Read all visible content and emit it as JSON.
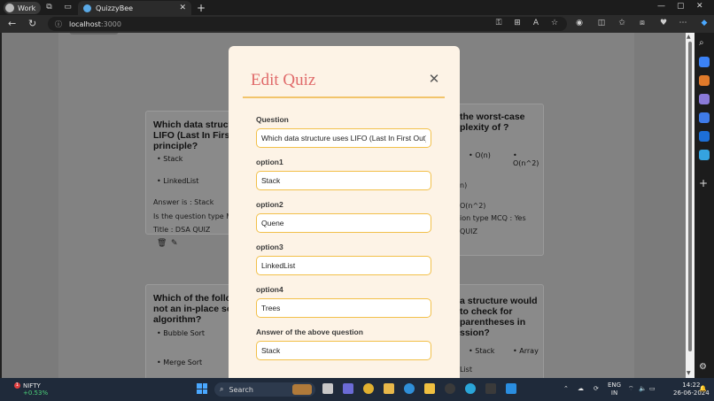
{
  "browser": {
    "profile_label": "Work",
    "tab_title": "QuizzyBee",
    "url_host": "localhost",
    "url_port": ":3000"
  },
  "modal": {
    "title": "Edit Quiz",
    "fields": [
      {
        "label": "Question",
        "value": "Which data structure uses LIFO (Last In First Out) principle?"
      },
      {
        "label": "option1",
        "value": "Stack"
      },
      {
        "label": "option2",
        "value": "Quene"
      },
      {
        "label": "option3",
        "value": "LinkedList"
      },
      {
        "label": "option4",
        "value": "Trees"
      },
      {
        "label": "Answer of the above question",
        "value": "Stack"
      }
    ]
  },
  "background_cards": {
    "card1": {
      "question_fragment": "Which data struct LIFO (Last In First principle?",
      "options": [
        "Stack",
        "LinkedList"
      ],
      "answer_line": "Answer is : Stack",
      "type_line": "Is the question type MC",
      "title_line": "Title : DSA QUIZ"
    },
    "card2": {
      "question_fragment": "the worst-case plexity of ?",
      "options": [
        "O(n)",
        "O(n^2)"
      ],
      "extra": [
        "n)",
        "O(n^2)"
      ],
      "type_line": "ion type MCQ : Yes",
      "title_line": "QUIZ"
    },
    "card3": {
      "question_fragment": "Which of the follo not an in-place so algorithm?",
      "options": [
        "Bubble Sort",
        "Merge Sort"
      ]
    },
    "card4": {
      "question_fragment": "a structure would to check for parentheses in ssion?",
      "options": [
        "Stack",
        "Array"
      ],
      "extra": [
        "List"
      ]
    }
  },
  "taskbar": {
    "ticker_name": "NIFTY",
    "ticker_change": "+0.53%",
    "notification_count": "1",
    "search_placeholder": "Search",
    "lang_line1": "ENG",
    "lang_line2": "IN",
    "time": "14:22",
    "date": "26-06-2024"
  }
}
